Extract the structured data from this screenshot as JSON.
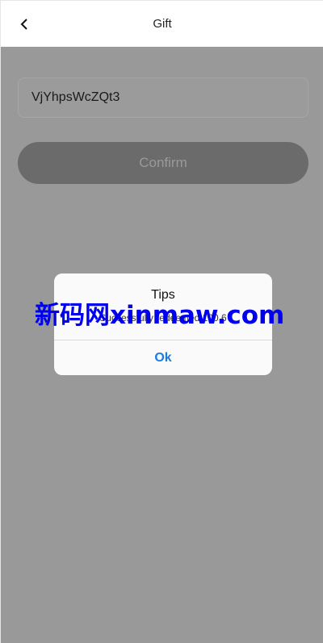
{
  "header": {
    "title": "Gift",
    "back_icon": "chevron-left-icon"
  },
  "form": {
    "code_value": "VjYhpsWcZQt3",
    "confirm_label": "Confirm"
  },
  "dialog": {
    "title": "Tips",
    "message": "Successfully redeemed 100.6",
    "ok_label": "Ok"
  },
  "watermark": {
    "text": "新码网xinmaw.com"
  },
  "colors": {
    "overlay": "#999999",
    "ok_accent": "#1a7ae6",
    "watermark": "#0000ee"
  }
}
